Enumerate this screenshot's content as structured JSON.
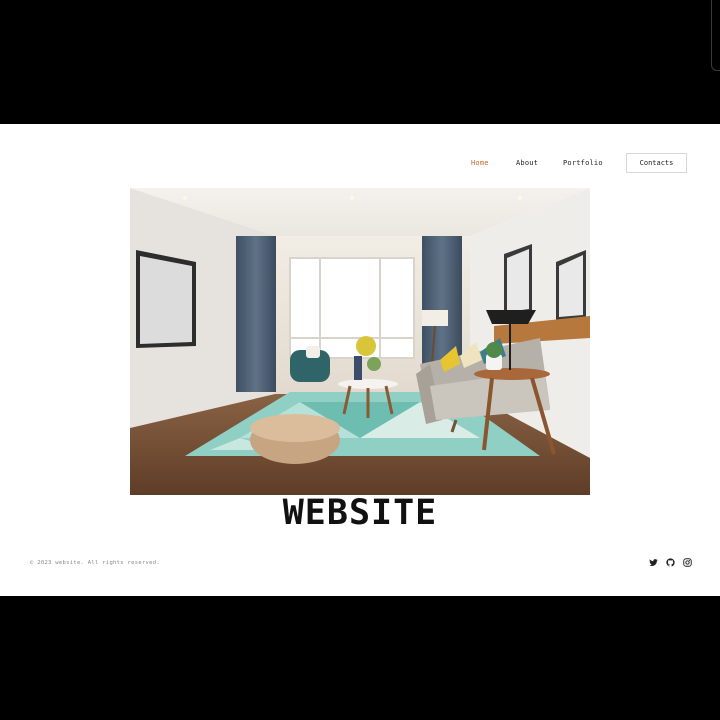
{
  "nav": {
    "items": [
      {
        "label": "Home",
        "active": true
      },
      {
        "label": "About",
        "active": false
      },
      {
        "label": "Portfolio",
        "active": false
      }
    ],
    "contacts_label": "Contacts",
    "accent_color": "#c8692a"
  },
  "hero": {
    "image_subject": "living-room-interior",
    "headline": "WEBSITE"
  },
  "footer": {
    "copyright": "© 2023 website. All rights reserved.",
    "social_icons": [
      "twitter-icon",
      "github-icon",
      "instagram-icon"
    ]
  }
}
